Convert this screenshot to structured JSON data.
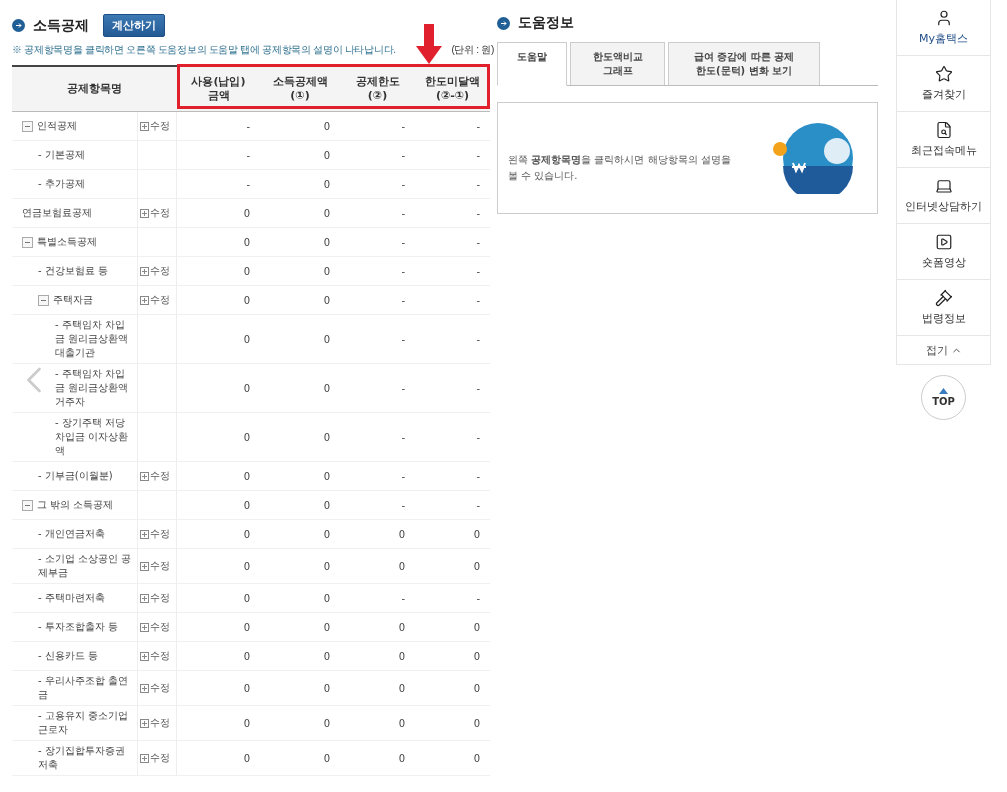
{
  "deduction": {
    "title": "소득공제",
    "calc_button": "계산하기",
    "notice": "※ 공제항목명을 클릭하면 오른쪽 도움정보의 도움말 탭에 공제항목의 설명이 나타납니다.",
    "unit": "(단위 : 원)",
    "amount_columns_highlighted": true,
    "columns": [
      "공제항목명",
      "사용(납입)\n금액",
      "소득공제액\n(①)",
      "공제한도\n(②)",
      "한도미달액\n(②-①)"
    ],
    "rows": [
      {
        "name": "인적공제",
        "expanded": true,
        "edit": "수정",
        "values": [
          "-",
          "0",
          "-",
          "-"
        ],
        "children": [
          {
            "name": "- 기본공제",
            "values": [
              "-",
              "0",
              "-",
              "-"
            ]
          },
          {
            "name": "- 추가공제",
            "values": [
              "-",
              "0",
              "-",
              "-"
            ]
          }
        ]
      },
      {
        "name": "연금보험료공제",
        "edit": "수정",
        "values": [
          "0",
          "0",
          "-",
          "-"
        ]
      },
      {
        "name": "특별소득공제",
        "expanded": true,
        "values": [
          "0",
          "0",
          "-",
          "-"
        ],
        "children": [
          {
            "name": "- 건강보험료 등",
            "edit": "수정",
            "values": [
              "0",
              "0",
              "-",
              "-"
            ]
          },
          {
            "name": "주택자금",
            "expanded": true,
            "edit": "수정",
            "values": [
              "0",
              "0",
              "-",
              "-"
            ],
            "children": [
              {
                "name": "- 주택임차 차입금 원리금상환액 대출기관",
                "values": [
                  "0",
                  "0",
                  "-",
                  "-"
                ]
              },
              {
                "name": "- 주택임차 차입금 원리금상환액 거주자",
                "values": [
                  "0",
                  "0",
                  "-",
                  "-"
                ]
              },
              {
                "name": "- 장기주택 저당차입금 이자상환액",
                "values": [
                  "0",
                  "0",
                  "-",
                  "-"
                ]
              }
            ]
          },
          {
            "name": "- 기부금(이월분)",
            "edit": "수정",
            "values": [
              "0",
              "0",
              "-",
              "-"
            ]
          }
        ]
      },
      {
        "name": "그 밖의 소득공제",
        "expanded": true,
        "values": [
          "0",
          "0",
          "-",
          "-"
        ],
        "children": [
          {
            "name": "- 개인연금저축",
            "edit": "수정",
            "values": [
              "0",
              "0",
              "0",
              "0"
            ]
          },
          {
            "name": "- 소기업 소상공인 공제부금",
            "edit": "수정",
            "values": [
              "0",
              "0",
              "0",
              "0"
            ]
          },
          {
            "name": "- 주택마련저축",
            "edit": "수정",
            "values": [
              "0",
              "0",
              "-",
              "-"
            ]
          },
          {
            "name": "- 투자조합출자 등",
            "edit": "수정",
            "values": [
              "0",
              "0",
              "0",
              "0"
            ]
          },
          {
            "name": "- 신용카드 등",
            "edit": "수정",
            "values": [
              "0",
              "0",
              "0",
              "0"
            ]
          },
          {
            "name": "- 우리사주조합 출연금",
            "edit": "수정",
            "values": [
              "0",
              "0",
              "0",
              "0"
            ]
          },
          {
            "name": "- 고용유지 중소기업 근로자",
            "edit": "수정",
            "values": [
              "0",
              "0",
              "0",
              "0"
            ]
          },
          {
            "name": "- 장기집합투자증권저축",
            "edit": "수정",
            "values": [
              "0",
              "0",
              "0",
              "0"
            ]
          }
        ]
      }
    ]
  },
  "help": {
    "title": "도움정보",
    "tabs": [
      {
        "label": "도움말",
        "selected": true
      },
      {
        "label": "한도액비교\n그래프",
        "selected": false
      },
      {
        "label": "급여 증감에 따른 공제\n한도(문턱) 변화 보기",
        "selected": false
      }
    ],
    "message": "왼쪽 **공제항목명**을 클릭하시면 해당항목의 설명을 볼 수 있습니다."
  },
  "quick_menu": {
    "items": [
      {
        "kind": "user",
        "label": "My홈택스",
        "selected": true
      },
      {
        "kind": "star",
        "label": "즐겨찾기",
        "selected": false
      },
      {
        "kind": "recent",
        "label": "최근접속메뉴",
        "selected": false
      },
      {
        "kind": "consult",
        "label": "인터넷상담하기",
        "selected": false
      },
      {
        "kind": "video",
        "label": "숏폼영상",
        "selected": false
      },
      {
        "kind": "law",
        "label": "법령정보",
        "selected": false
      }
    ],
    "collapse": "접기",
    "top": "TOP"
  }
}
